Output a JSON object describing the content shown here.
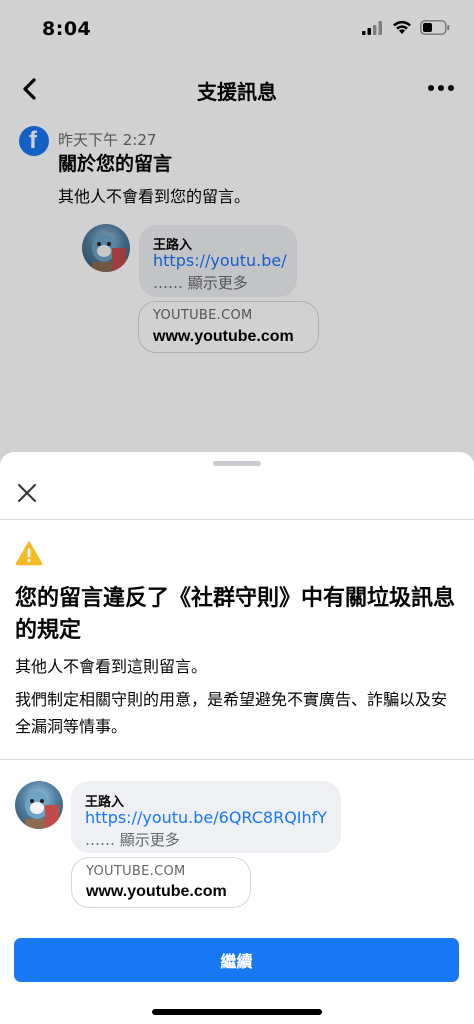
{
  "status_bar": {
    "time": "8:04"
  },
  "header": {
    "title": "支援訊息"
  },
  "message": {
    "time": "昨天下午 2:27",
    "title": "關於您的留言",
    "subtitle": "其他人不會看到您的留言。"
  },
  "comment": {
    "author": "王路入",
    "link_short": "https://youtu.be/",
    "link_full": "https://youtu.be/6QRC8RQIhfY",
    "show_more": "…… 顯示更多",
    "preview_domain": "YOUTUBE.COM",
    "preview_site": "www.youtube.com"
  },
  "sheet": {
    "title": "您的留言違反了《社群守則》中有關垃圾訊息的規定",
    "line1": "其他人不會看到這則留言。",
    "line2": "我們制定相關守則的用意，是希望避免不實廣告、詐騙以及安全漏洞等情事。",
    "continue_label": "繼續"
  },
  "colors": {
    "accent": "#1877f2",
    "warning": "#f7b928",
    "bubble": "#eef0f3"
  },
  "icons": [
    "back-arrow-icon",
    "more-icon",
    "facebook-logo-icon",
    "close-icon",
    "warning-icon",
    "signal-icon",
    "wifi-icon",
    "battery-icon"
  ]
}
